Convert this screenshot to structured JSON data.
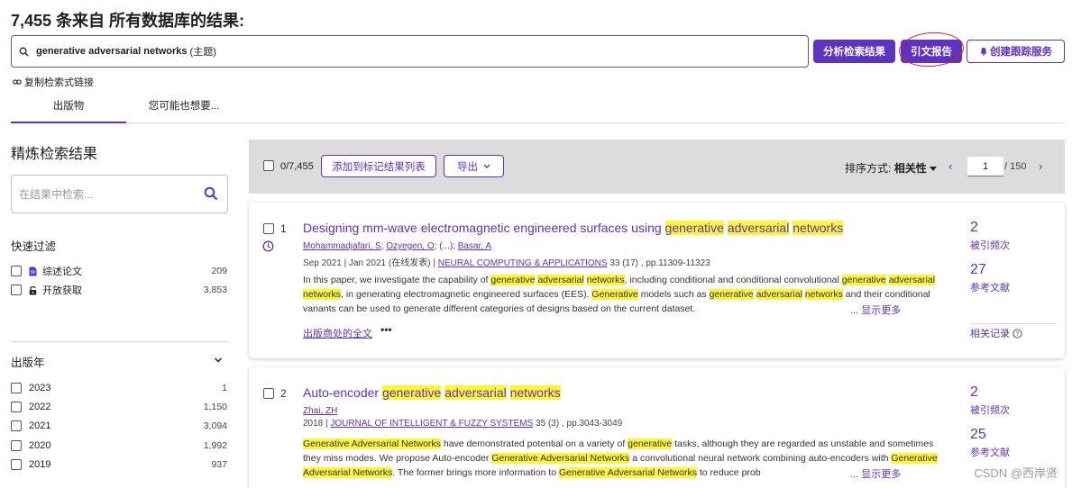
{
  "header": {
    "results_title": "7,455 条来自 所有数据库的结果:",
    "query": "generative adversarial networks",
    "query_field": "(主题)",
    "analyze_label": "分析检索结果",
    "citation_label": "引文报告",
    "alert_label": "创建跟踪服务",
    "copy_link_label": "复制检索式链接"
  },
  "tabs": [
    {
      "label": "出版物",
      "active": true
    },
    {
      "label": "您可能也想要..."
    }
  ],
  "sidebar": {
    "title": "精炼检索结果",
    "search_placeholder": "在结果中检索...",
    "quick_filter_title": "快速过滤",
    "quick_filters": [
      {
        "label": "综述论文",
        "icon": "document-icon",
        "count": "209"
      },
      {
        "label": "开放获取",
        "icon": "lock-open-icon",
        "count": "3,853"
      }
    ],
    "pub_year_title": "出版年",
    "years": [
      {
        "label": "2023",
        "count": "1"
      },
      {
        "label": "2022",
        "count": "1,150"
      },
      {
        "label": "2021",
        "count": "3,094"
      },
      {
        "label": "2020",
        "count": "1,992"
      },
      {
        "label": "2019",
        "count": "937"
      }
    ]
  },
  "toolbar": {
    "selected_count": "0/7,455",
    "add_marked_label": "添加到标记结果列表",
    "export_label": "导出",
    "sort_prefix": "排序方式:",
    "sort_value": "相关性",
    "page_current": "1",
    "page_total": "/ 150"
  },
  "records": [
    {
      "num": "1",
      "title_parts": [
        "Designing mm-wave electromagnetic engineered surfaces using ",
        "generative",
        " ",
        "adversarial",
        " ",
        "networks"
      ],
      "authors": [
        "Mohammadjafari, S",
        "Ozyegen, O",
        "(...)",
        "Basar, A"
      ],
      "date": "Sep 2021 | Jan 2021 (在线发表)",
      "journal": "NEURAL COMPUTING & APPLICATIONS",
      "volume": "33 (17) , pp.11309-11323",
      "abstract_parts": [
        "In this paper, we investigate the capability of ",
        "generative",
        " ",
        "adversarial",
        " ",
        "networks",
        ", including conditional and conditional convolutional ",
        "generative",
        " ",
        "adversarial",
        " ",
        "networks",
        ", in generating electromagnetic engineered surfaces (EES). ",
        "Generative",
        " models such as ",
        "generative",
        " ",
        "adversarial",
        " ",
        "networks",
        " and their conditional variants can be used to generate different categories of designs based on the current dataset."
      ],
      "show_more": "... 显示更多",
      "full_text_label": "出版商处的全文",
      "times_cited": "2",
      "times_cited_label": "被引频次",
      "references": "27",
      "references_label": "参考文献",
      "related_label": "相关记录"
    },
    {
      "num": "2",
      "title_parts": [
        "Auto-encoder ",
        "generative",
        " ",
        "adversarial",
        " ",
        "networks"
      ],
      "authors": [
        "Zhai, ZH"
      ],
      "date": "2018",
      "journal": "JOURNAL OF INTELLIGENT & FUZZY SYSTEMS",
      "volume": "35 (3) , pp.3043-3049",
      "abstract_parts": [
        "Generative",
        " ",
        "Adversarial",
        " ",
        "Networks",
        " have demonstrated potential on a variety of ",
        "generative",
        " tasks, although they are regarded as unstable and sometimes they miss modes. We propose Auto-encoder ",
        "Generative",
        " ",
        "Adversarial",
        " ",
        "Networks",
        " a convolutional neural network combining auto-encoders with ",
        "Generative",
        " ",
        "Adversarial",
        " ",
        "Networks",
        ". The former brings more information to ",
        "Generative",
        " ",
        "Adversarial",
        " ",
        "Networks",
        " to reduce prob"
      ],
      "show_more": "... 显示更多",
      "times_cited": "2",
      "times_cited_label": "被引频次",
      "references": "25",
      "references_label": "参考文献"
    }
  ],
  "watermark": "CSDN @西岸贤",
  "colors": {
    "accent": "#5e33bf",
    "highlight": "#fdf53a",
    "annotation": "#e02020"
  }
}
